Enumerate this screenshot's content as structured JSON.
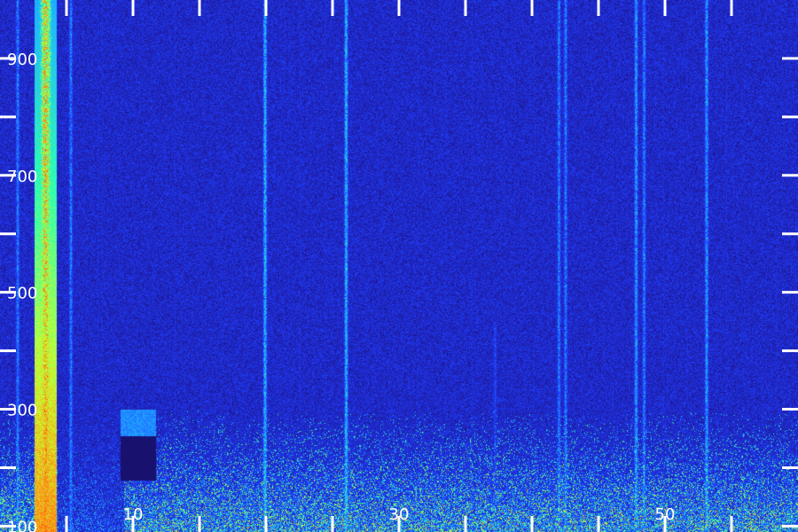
{
  "chart_data": {
    "type": "heatmap",
    "title": "",
    "xlabel": "",
    "ylabel": "",
    "x_tick_labels": [
      "10",
      "30",
      "50"
    ],
    "x_tick_values": [
      10,
      30,
      50
    ],
    "y_tick_labels": [
      "100",
      "300",
      "500",
      "700",
      "900"
    ],
    "y_tick_values": [
      100,
      300,
      500,
      700,
      900
    ],
    "xlim": [
      0,
      60
    ],
    "ylim": [
      90,
      1000
    ],
    "grid": false,
    "legend": "none",
    "colormap": [
      "#140a4a",
      "#1e1aa0",
      "#2040ff",
      "#1fb4ff",
      "#30ffb0",
      "#c8ff30",
      "#ff8c14",
      "#ff2000"
    ],
    "background_color": "#140a4a",
    "tick_color": "#ffffff",
    "label_color": "#ffffff",
    "event_onset_time": 9.3,
    "event_upper_frequency": 300,
    "vertical_bands": [
      {
        "time": 3.4,
        "intensity": 0.95,
        "freq_top": 1000
      },
      {
        "time": 1.3,
        "intensity": 0.45,
        "freq_top": 1000
      },
      {
        "time": 5.3,
        "intensity": 0.45,
        "freq_top": 1000
      },
      {
        "time": 19.9,
        "intensity": 0.55,
        "freq_top": 1000
      },
      {
        "time": 26.0,
        "intensity": 0.55,
        "freq_top": 1000
      },
      {
        "time": 37.2,
        "intensity": 0.35,
        "freq_top": 450
      },
      {
        "time": 42.0,
        "intensity": 0.45,
        "freq_top": 1000
      },
      {
        "time": 42.5,
        "intensity": 0.45,
        "freq_top": 1000
      },
      {
        "time": 47.8,
        "intensity": 0.5,
        "freq_top": 1000
      },
      {
        "time": 48.4,
        "intensity": 0.45,
        "freq_top": 1000
      },
      {
        "time": 53.1,
        "intensity": 0.5,
        "freq_top": 1000
      }
    ]
  }
}
